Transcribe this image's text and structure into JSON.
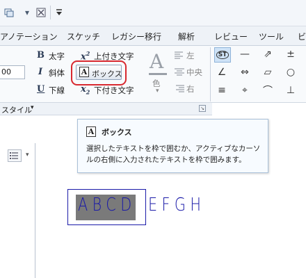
{
  "quick_access": {
    "icons": [
      "layers-icon",
      "dropdown-arrow-icon",
      "close-windows-icon",
      "customize-toolbar-icon"
    ]
  },
  "ribbon_tabs": [
    {
      "label": "アノテーション"
    },
    {
      "label": "スケッチ"
    },
    {
      "label": "レガシー移行"
    },
    {
      "label": "解析"
    },
    {
      "label": "レビュー"
    },
    {
      "label": "ツール"
    },
    {
      "label": "ビ"
    }
  ],
  "ribbon": {
    "font_size_value": "00",
    "bold_label": "太字",
    "italic_label": "斜体",
    "underline_label": "下線",
    "superscript_label": "上付き文字",
    "box_label": "ボックス",
    "subscript_label": "下付き文字",
    "color_label": "色",
    "align_left_label": "左",
    "align_center_label": "中央",
    "align_right_label": "右",
    "symbol_st": "ST"
  },
  "group_bar": {
    "style_label": "スタイル"
  },
  "tooltip": {
    "title": "ボックス",
    "description": "選択したテキストを枠で囲むか、アクティブなカーソルの右側に入力されたテキストを枠で囲みます。"
  },
  "canvas": {
    "selected_text": "ABCD",
    "following_text": "EFGH"
  },
  "colors": {
    "highlight_outline": "#d8282f",
    "annotation_blue": "#1a1aa8",
    "selection_fill": "#7a7a7a"
  }
}
